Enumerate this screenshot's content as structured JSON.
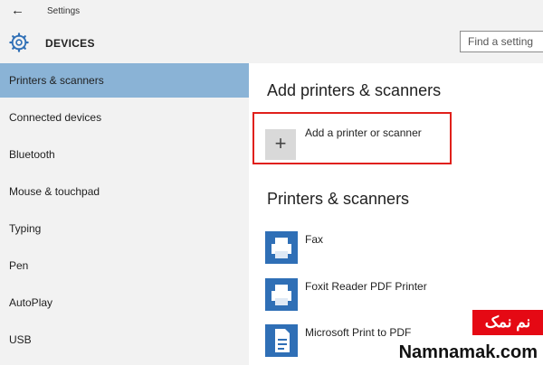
{
  "window": {
    "title": "Settings",
    "back_glyph": "←"
  },
  "header": {
    "section_title": "DEVICES",
    "search_placeholder": "Find a setting",
    "icon": "gear-icon"
  },
  "sidebar": {
    "items": [
      {
        "label": "Printers & scanners",
        "active": true
      },
      {
        "label": "Connected devices",
        "active": false
      },
      {
        "label": "Bluetooth",
        "active": false
      },
      {
        "label": "Mouse & touchpad",
        "active": false
      },
      {
        "label": "Typing",
        "active": false
      },
      {
        "label": "Pen",
        "active": false
      },
      {
        "label": "AutoPlay",
        "active": false
      },
      {
        "label": "USB",
        "active": false
      }
    ]
  },
  "main": {
    "add_heading": "Add printers & scanners",
    "add_button": {
      "symbol": "+",
      "label": "Add a printer or scanner"
    },
    "list_heading": "Printers & scanners",
    "devices": [
      {
        "name": "Fax",
        "icon": "printer-icon"
      },
      {
        "name": "Foxit Reader PDF Printer",
        "icon": "printer-icon"
      },
      {
        "name": "Microsoft Print to PDF",
        "icon": "document-printer-icon"
      }
    ]
  },
  "watermark": {
    "persian": "نم نمک",
    "latin": "Namnamak.com"
  },
  "colors": {
    "accent_selected": "#8ab3d6",
    "highlight_border": "#e0201b",
    "icon_blue": "#2f6fb6",
    "watermark_red": "#e50914"
  }
}
